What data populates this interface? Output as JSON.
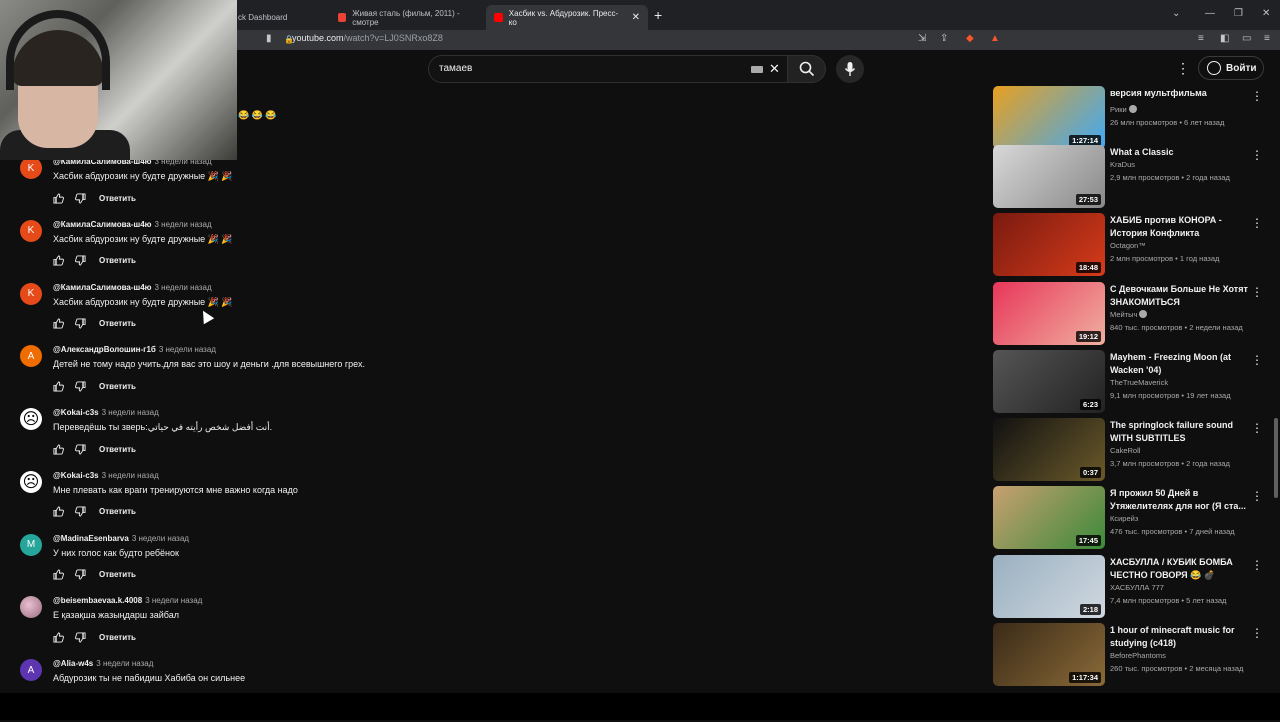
{
  "browser": {
    "tabs": [
      {
        "title": "ck Dashboard",
        "active": false,
        "favicon_color": "#202124"
      },
      {
        "title": "Живая сталь (фильм, 2011) - смотре",
        "active": false,
        "favicon_color": "#ea4335"
      },
      {
        "title": "Хасбик vs. Абдурозик. Пресс-ко",
        "active": true,
        "favicon_color": "#ff0000"
      }
    ],
    "new_tab": "+",
    "url_domain": "youtube.com",
    "url_path": "/watch?v=LJ0SNRxo8Z8"
  },
  "youtube": {
    "search_value": "тамаев",
    "sign_in_label": "Войти"
  },
  "comments": [
    {
      "author": "@КамилаСалимова-ш4ю",
      "time": "3 недели назад",
      "text": "Хасбик абдурозик ну будте дружные 🎉 🎉",
      "avatar_letter": "K",
      "avatar_color": "#e64a19",
      "reply": "Ответить"
    },
    {
      "author": "@КамилаСалимова-ш4ю",
      "time": "3 недели назад",
      "text": "Хасбик абдурозик ну будте дружные 🎉 🎉",
      "avatar_letter": "K",
      "avatar_color": "#e64a19",
      "reply": "Ответить"
    },
    {
      "author": "@КамилаСалимова-ш4ю",
      "time": "3 недели назад",
      "text": "Хасбик абдурозик ну будте дружные 🎉 🎉",
      "avatar_letter": "K",
      "avatar_color": "#e64a19",
      "reply": "Ответить"
    },
    {
      "author": "@АлександрВолошин-г1б",
      "time": "3 недели назад",
      "text": "Детей  не тому надо учить.для вас это шоу и деньги .для всевышнего  грех.",
      "avatar_letter": "A",
      "avatar_color": "#ef6c00",
      "reply": "Ответить"
    },
    {
      "author": "@Kokai-c3s",
      "time": "3 недели назад",
      "text": "Переведёшь ты зверь:أنت أفضل شخص رأيته في حياتي.",
      "avatar_letter": "☹",
      "avatar_color": "#ffffff",
      "reply": "Ответить"
    },
    {
      "author": "@Kokai-c3s",
      "time": "3 недели назад",
      "text": "Мне плевать как враги тренируются мне важно когда надо",
      "avatar_letter": "☹",
      "avatar_color": "#ffffff",
      "reply": "Ответить"
    },
    {
      "author": "@MadinaEsenbarva",
      "time": "3 недели назад",
      "text": "У них голос как будто ребёнок",
      "avatar_letter": "M",
      "avatar_color": "#26a69a",
      "reply": "Ответить"
    },
    {
      "author": "@beisembaevaa.k.4008",
      "time": "3 недели назад",
      "text": "Е қазақша жазыңдарш зайбал",
      "avatar_letter": "",
      "avatar_color": "#c78fa8",
      "reply": "Ответить"
    },
    {
      "author": "@Alia-w4s",
      "time": "3 недели назад",
      "text": "Абдурозик ты не пабидиш Хабиба он сильнее",
      "avatar_letter": "A",
      "avatar_color": "#5e35b1",
      "reply": ""
    }
  ],
  "emoji_row": "😂 😂 😂",
  "sidebar": [
    {
      "title": "версия мультфильма",
      "channel": "Рики",
      "verified": true,
      "meta": "26 млн просмотров • 6 лет назад",
      "duration": "1:27:14",
      "thumb": [
        "#e8a020",
        "#3fa9f5"
      ]
    },
    {
      "title": "What a Classic",
      "channel": "KraDus",
      "verified": false,
      "meta": "2,9 млн просмотров • 2 года назад",
      "duration": "27:53",
      "thumb": [
        "#d8d8d8",
        "#888888"
      ]
    },
    {
      "title": "ХАБИБ против КОНОРА - История Конфликта",
      "channel": "Octagon™",
      "verified": false,
      "meta": "2 млн просмотров • 1 год назад",
      "duration": "18:48",
      "thumb": [
        "#7a1a10",
        "#d63b1a"
      ]
    },
    {
      "title": "С Девочками Больше Не Хотят ЗНАКОМИТЬСЯ",
      "channel": "Мейтыч",
      "verified": true,
      "meta": "840 тыс. просмотров • 2 недели назад",
      "duration": "19:12",
      "thumb": [
        "#e8365a",
        "#f0b0a0"
      ]
    },
    {
      "title": "Mayhem - Freezing Moon (at Wacken '04)",
      "channel": "TheTrueMaverick",
      "verified": false,
      "meta": "9,1 млн просмотров • 19 лет назад",
      "duration": "6:23",
      "thumb": [
        "#555555",
        "#222222"
      ]
    },
    {
      "title": "The springlock failure sound WITH SUBTITLES",
      "channel": "CakeRoll",
      "verified": false,
      "meta": "3,7 млн просмотров • 2 года назад",
      "duration": "0:37",
      "thumb": [
        "#111111",
        "#6b5a2a"
      ]
    },
    {
      "title": "Я прожил 50 Дней в Утяжелителях для ног (Я ста...",
      "channel": "Ксирейз",
      "verified": false,
      "meta": "476 тыс. просмотров • 7 дней назад",
      "duration": "17:45",
      "thumb": [
        "#c8a070",
        "#3a8a3a"
      ]
    },
    {
      "title": "ХАСБУЛЛА / КУБИК БОМБА ЧЕСТНО ГОВОРЯ 😂 💣",
      "channel": "ХАСБУЛЛА 777",
      "verified": false,
      "meta": "7,4 млн просмотров • 5 лет назад",
      "duration": "2:18",
      "thumb": [
        "#9ab0c0",
        "#d0d8e0"
      ]
    },
    {
      "title": "1 hour of minecraft music for studying (c418)",
      "channel": "BeforePhantoms",
      "verified": false,
      "meta": "260 тыс. просмотров • 2 месяца назад",
      "duration": "1:17:34",
      "thumb": [
        "#3a2a18",
        "#8a6a38"
      ]
    }
  ]
}
